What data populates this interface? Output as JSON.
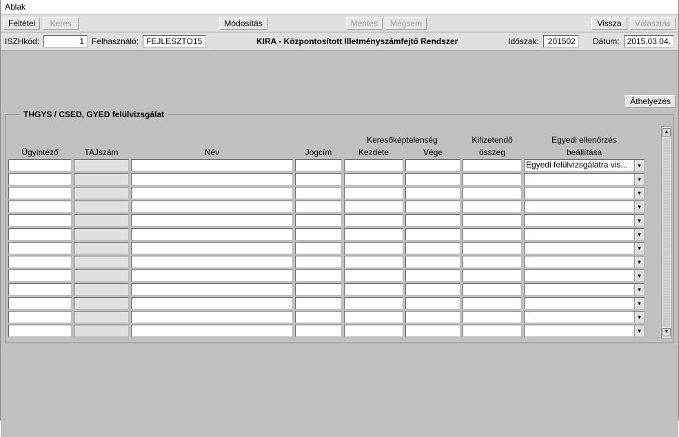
{
  "menu": {
    "ablak": "Ablak"
  },
  "toolbar": {
    "feltetel": "Feltétel",
    "keres": "Keres",
    "modositas": "Módosítás",
    "mentes": "Mentés",
    "megsem": "Mégsem",
    "vissza": "Vissza",
    "valasztas": "Választás"
  },
  "info": {
    "iszh_label": "ISZHkód:",
    "iszh_value": "1",
    "felh_label": "Felhasználó:",
    "felh_value": "FEJLESZTO15",
    "title": "KIRA - Központosított Illetményszámfejtő Rendszer",
    "idoszak_label": "Időszak:",
    "idoszak_value": "201502",
    "datum_label": "Dátum:",
    "datum_value": "2015.03.04."
  },
  "transfer_button": "Áthelyezés",
  "legend": "THGYS / CSED, GYED felülvizsgálat",
  "headers": {
    "ugyintezo": "Ügyintéző",
    "tajszam": "TAJszám",
    "nev": "Név",
    "jogcim": "Jogcím",
    "kereso_top": "Keresőképtelenség",
    "kereso_kezd": "Kezdete",
    "kereso_vege": "Vége",
    "kifiz_top": "Kifizetendő",
    "kifiz_bot": "összeg",
    "egyedi_top": "Egyedi ellenőrzés",
    "egyedi_bot": "beállítása"
  },
  "dropdown_first_value": "Egyedi felülvizsgálatra vis...",
  "row_count": 13
}
